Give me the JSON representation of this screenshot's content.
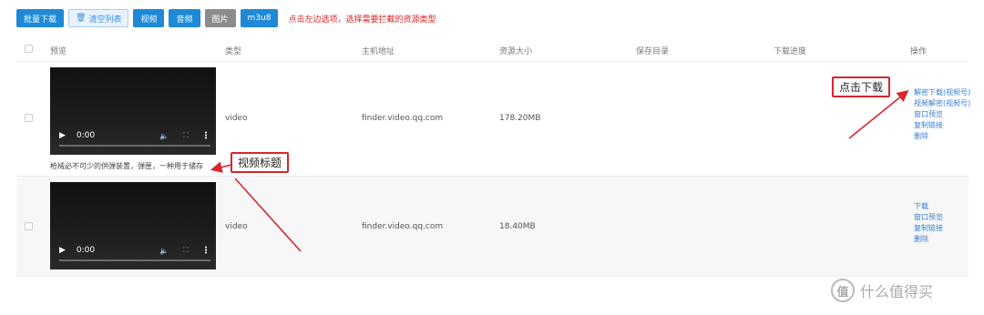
{
  "toolbar": {
    "batch_download": "批量下载",
    "clear_list": "清空列表",
    "video": "视频",
    "audio": "音频",
    "image": "图片",
    "m3u8": "m3u8",
    "hint": "点击左边选项，选择需要拦截的资源类型"
  },
  "table": {
    "headers": {
      "preview": "预览",
      "type": "类型",
      "host": "主机地址",
      "size": "资源大小",
      "save_dir": "保存目录",
      "progress": "下载进度",
      "actions": "操作"
    },
    "rows": [
      {
        "time": "0:00",
        "title": "枪械必不可少的供弹装置，弹匣，一种用于储存",
        "type": "video",
        "host": "finder.video.qq.com",
        "size": "178.20MB",
        "actions": [
          "解密下载(视频号)",
          "视频解密(视频号)",
          "窗口预览",
          "复制链接",
          "删除"
        ]
      },
      {
        "time": "0:00",
        "title": "",
        "type": "video",
        "host": "finder.video.qq.com",
        "size": "18.40MB",
        "actions": [
          "下载",
          "窗口预览",
          "复制链接",
          "删除"
        ]
      }
    ]
  },
  "annotations": {
    "click_download": "点击下载",
    "video_title": "视频标题"
  },
  "watermark": {
    "logo": "值",
    "text": "什么值得买"
  },
  "colors": {
    "primary": "#1e89d6",
    "annotation_red": "#d7262d",
    "link": "#3a7fd0"
  }
}
